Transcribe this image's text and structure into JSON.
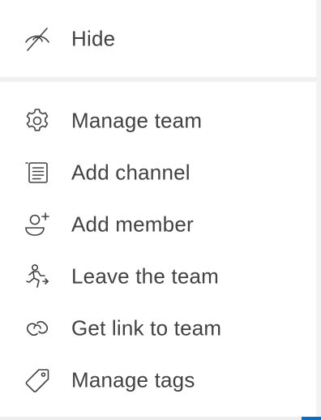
{
  "menu": {
    "items": [
      {
        "label": "Hide",
        "icon": "eye-off-icon"
      },
      {
        "label": "Manage team",
        "icon": "gear-icon"
      },
      {
        "label": "Add channel",
        "icon": "channel-list-icon"
      },
      {
        "label": "Add member",
        "icon": "person-add-icon"
      },
      {
        "label": "Leave the team",
        "icon": "running-person-icon"
      },
      {
        "label": "Get link to team",
        "icon": "link-icon"
      },
      {
        "label": "Manage tags",
        "icon": "tag-icon"
      }
    ]
  },
  "colors": {
    "text": "#424242",
    "icon": "#424242",
    "divider": "#f0f0f0",
    "accent": "#0f6cbd"
  }
}
